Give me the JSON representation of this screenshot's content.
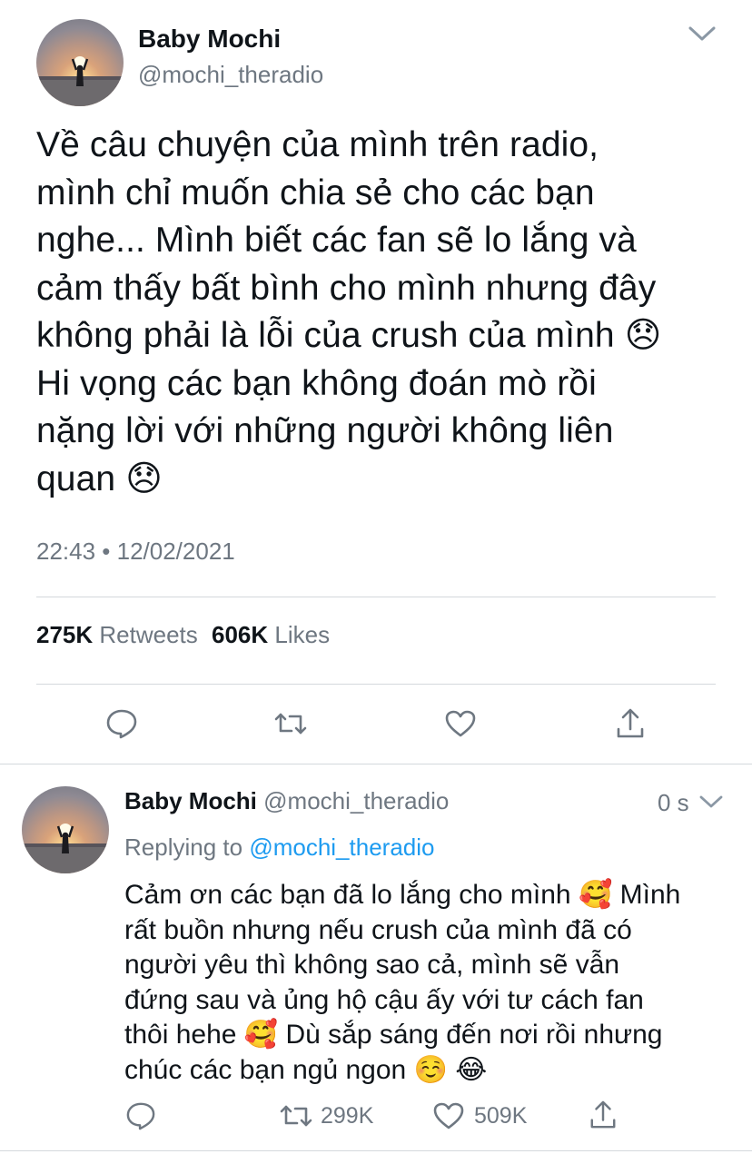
{
  "tweet": {
    "author_name": "Baby Mochi",
    "handle": "@mochi_theradio",
    "text": "Về câu chuyện của mình trên radio,\nmình chỉ muốn chia sẻ cho các bạn\nnghe... Mình biết các fan sẽ lo lắng và\ncảm thấy bất bình cho mình nhưng đây\nkhông phải là lỗi của crush của mình 😞\nHi vọng các bạn không đoán mò rồi\nnặng lời với những người không liên\nquan 😞",
    "timestamp": "22:43 • 12/02/2021",
    "retweets_count": "275K",
    "retweets_label": "Retweets",
    "likes_count": "606K",
    "likes_label": "Likes"
  },
  "reply": {
    "author_name": "Baby Mochi",
    "handle": "@mochi_theradio",
    "time": "0 s",
    "replying_prefix": "Replying to",
    "replying_handle": "@mochi_theradio",
    "text": "Cảm ơn các bạn đã lo lắng cho mình 🥰 Mình\nrất buồn nhưng nếu crush của mình đã có\nngười yêu thì không sao cả, mình sẽ vẫn\nđứng sau và ủng hộ cậu ấy với tư cách fan\nthôi hehe 🥰 Dù sắp sáng đến nơi rồi nhưng\nchúc các bạn ngủ ngon ☺️ 😂",
    "retweets_count": "299K",
    "likes_count": "509K"
  },
  "icons": {
    "reply": "speech-bubble-icon",
    "retweet": "retweet-arrows-icon",
    "like": "heart-outline-icon",
    "share": "share-upload-icon",
    "menu": "chevron-down-icon"
  },
  "colors": {
    "text": "#0f1419",
    "secondary": "#6e7781",
    "link": "#1d9bf0",
    "divider": "#d4d8dc"
  }
}
